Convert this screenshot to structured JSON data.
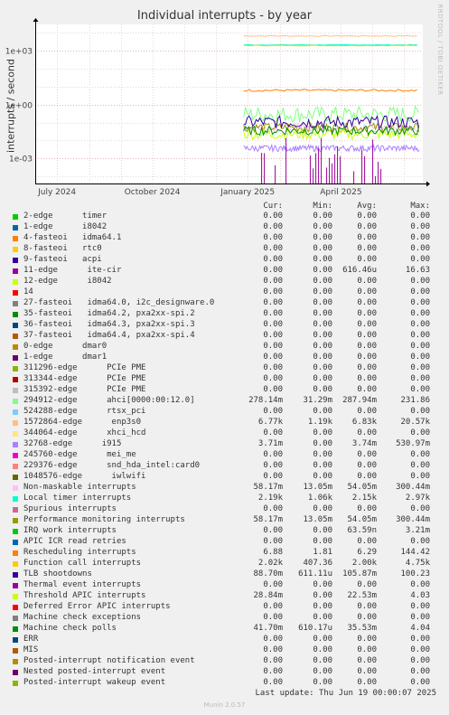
{
  "title": "Individual interrupts - by year",
  "side_text": "RRDTOOL / TOBI OETIKER",
  "footer": "Munin 2.0.57",
  "last_update": "Last update: Thu Jun 19 00:00:07 2025",
  "headers": {
    "cur": "Cur:",
    "min": "Min:",
    "avg": "Avg:",
    "max": "Max:"
  },
  "chart_data": {
    "type": "line",
    "ylabel": "interrupts / second",
    "yscale": "log",
    "ylim": [
      4e-05,
      30000
    ],
    "y_ticks": [
      {
        "value": 1000,
        "label": "1e+03"
      },
      {
        "value": 1,
        "label": "1e+00"
      },
      {
        "value": 0.001,
        "label": "1e-03"
      }
    ],
    "x_ticks": [
      "July 2024",
      "October 2024",
      "January 2025",
      "April 2025"
    ],
    "x_tick_dates": [
      "2024-07-01",
      "2024-10-01",
      "2025-01-01",
      "2025-04-01"
    ],
    "xlim": [
      "2024-06-10",
      "2025-06-19"
    ],
    "data_start": "2024-12-28",
    "grid": true,
    "series": [
      {
        "name": "2-edge      timer",
        "color": "#00cc00",
        "cur": "0.00",
        "min": "0.00",
        "avg": "0.00",
        "max": "0.00"
      },
      {
        "name": "1-edge      i8042",
        "color": "#0066b3",
        "cur": "0.00",
        "min": "0.00",
        "avg": "0.00",
        "max": "0.00"
      },
      {
        "name": "4-fasteoi   idma64.1",
        "color": "#ff8000",
        "cur": "0.00",
        "min": "0.00",
        "avg": "0.00",
        "max": "0.00"
      },
      {
        "name": "8-fasteoi   rtc0",
        "color": "#ffcc00",
        "cur": "0.00",
        "min": "0.00",
        "avg": "0.00",
        "max": "0.00"
      },
      {
        "name": "9-fasteoi   acpi",
        "color": "#330099",
        "cur": "0.00",
        "min": "0.00",
        "avg": "0.00",
        "max": "0.00"
      },
      {
        "name": "11-edge      ite-cir",
        "color": "#990099",
        "cur": "0.00",
        "min": "0.00",
        "avg": "616.46u",
        "max": "16.63"
      },
      {
        "name": "12-edge      i8042",
        "color": "#ccff00",
        "cur": "0.00",
        "min": "0.00",
        "avg": "0.00",
        "max": "0.00"
      },
      {
        "name": "14",
        "color": "#ff0000",
        "cur": "0.00",
        "min": "0.00",
        "avg": "0.00",
        "max": "0.00"
      },
      {
        "name": "27-fasteoi   idma64.0, i2c_designware.0",
        "color": "#808080",
        "cur": "0.00",
        "min": "0.00",
        "avg": "0.00",
        "max": "0.00"
      },
      {
        "name": "35-fasteoi   idma64.2, pxa2xx-spi.2",
        "color": "#008f00",
        "cur": "0.00",
        "min": "0.00",
        "avg": "0.00",
        "max": "0.00"
      },
      {
        "name": "36-fasteoi   idma64.3, pxa2xx-spi.3",
        "color": "#00487d",
        "cur": "0.00",
        "min": "0.00",
        "avg": "0.00",
        "max": "0.00"
      },
      {
        "name": "37-fasteoi   idma64.4, pxa2xx-spi.4",
        "color": "#b35a00",
        "cur": "0.00",
        "min": "0.00",
        "avg": "0.00",
        "max": "0.00"
      },
      {
        "name": "0-edge      dmar0",
        "color": "#b38f00",
        "cur": "0.00",
        "min": "0.00",
        "avg": "0.00",
        "max": "0.00"
      },
      {
        "name": "1-edge      dmar1",
        "color": "#6b006b",
        "cur": "0.00",
        "min": "0.00",
        "avg": "0.00",
        "max": "0.00"
      },
      {
        "name": "311296-edge      PCIe PME",
        "color": "#8fb300",
        "cur": "0.00",
        "min": "0.00",
        "avg": "0.00",
        "max": "0.00"
      },
      {
        "name": "313344-edge      PCIe PME",
        "color": "#b30000",
        "cur": "0.00",
        "min": "0.00",
        "avg": "0.00",
        "max": "0.00"
      },
      {
        "name": "315392-edge      PCIe PME",
        "color": "#bebebe",
        "cur": "0.00",
        "min": "0.00",
        "avg": "0.00",
        "max": "0.00"
      },
      {
        "name": "294912-edge      ahci[0000:00:12.0]",
        "color": "#80ff80",
        "cur": "278.14m",
        "min": "31.29m",
        "avg": "287.94m",
        "max": "231.86"
      },
      {
        "name": "524288-edge      rtsx_pci",
        "color": "#80c9ff",
        "cur": "0.00",
        "min": "0.00",
        "avg": "0.00",
        "max": "0.00"
      },
      {
        "name": "1572864-edge      enp3s0",
        "color": "#ffc080",
        "cur": "6.77k",
        "min": "1.19k",
        "avg": "6.83k",
        "max": "20.57k"
      },
      {
        "name": "344064-edge      xhci_hcd",
        "color": "#ffe680",
        "cur": "0.00",
        "min": "0.00",
        "avg": "0.00",
        "max": "0.00"
      },
      {
        "name": "32768-edge      i915",
        "color": "#aa80ff",
        "cur": "3.71m",
        "min": "0.00",
        "avg": "3.74m",
        "max": "530.97m"
      },
      {
        "name": "245760-edge      mei_me",
        "color": "#ee00cc",
        "cur": "0.00",
        "min": "0.00",
        "avg": "0.00",
        "max": "0.00"
      },
      {
        "name": "229376-edge      snd_hda_intel:card0",
        "color": "#ff8080",
        "cur": "0.00",
        "min": "0.00",
        "avg": "0.00",
        "max": "0.00"
      },
      {
        "name": "1048576-edge      iwlwifi",
        "color": "#666600",
        "cur": "0.00",
        "min": "0.00",
        "avg": "0.00",
        "max": "0.00"
      },
      {
        "name": "Non-maskable interrupts",
        "color": "#ffbfff",
        "cur": "58.17m",
        "min": "13.05m",
        "avg": "54.05m",
        "max": "300.44m"
      },
      {
        "name": "Local timer interrupts",
        "color": "#00ffcc",
        "cur": "2.19k",
        "min": "1.06k",
        "avg": "2.15k",
        "max": "2.97k"
      },
      {
        "name": "Spurious interrupts",
        "color": "#cc6699",
        "cur": "0.00",
        "min": "0.00",
        "avg": "0.00",
        "max": "0.00"
      },
      {
        "name": "Performance monitoring interrupts",
        "color": "#999900",
        "cur": "58.17m",
        "min": "13.05m",
        "avg": "54.05m",
        "max": "300.44m"
      },
      {
        "name": "IRQ work interrupts",
        "color": "#00cc00",
        "cur": "0.00",
        "min": "0.00",
        "avg": "63.59n",
        "max": "3.21m"
      },
      {
        "name": "APIC ICR read retries",
        "color": "#0066b3",
        "cur": "0.00",
        "min": "0.00",
        "avg": "0.00",
        "max": "0.00"
      },
      {
        "name": "Rescheduling interrupts",
        "color": "#ff8000",
        "cur": "6.88",
        "min": "1.81",
        "avg": "6.29",
        "max": "144.42"
      },
      {
        "name": "Function call interrupts",
        "color": "#ffcc00",
        "cur": "2.02k",
        "min": "407.36",
        "avg": "2.00k",
        "max": "4.75k"
      },
      {
        "name": "TLB shootdowns",
        "color": "#330099",
        "cur": "88.70m",
        "min": "611.11u",
        "avg": "105.87m",
        "max": "100.23"
      },
      {
        "name": "Thermal event interrupts",
        "color": "#990099",
        "cur": "0.00",
        "min": "0.00",
        "avg": "0.00",
        "max": "0.00"
      },
      {
        "name": "Threshold APIC interrupts",
        "color": "#ccff00",
        "cur": "28.84m",
        "min": "0.00",
        "avg": "22.53m",
        "max": "4.03"
      },
      {
        "name": "Deferred Error APIC interrupts",
        "color": "#ff0000",
        "cur": "0.00",
        "min": "0.00",
        "avg": "0.00",
        "max": "0.00"
      },
      {
        "name": "Machine check exceptions",
        "color": "#808080",
        "cur": "0.00",
        "min": "0.00",
        "avg": "0.00",
        "max": "0.00"
      },
      {
        "name": "Machine check polls",
        "color": "#008f00",
        "cur": "41.70m",
        "min": "610.17u",
        "avg": "35.53m",
        "max": "4.04"
      },
      {
        "name": "ERR",
        "color": "#00487d",
        "cur": "0.00",
        "min": "0.00",
        "avg": "0.00",
        "max": "0.00"
      },
      {
        "name": "MIS",
        "color": "#b35a00",
        "cur": "0.00",
        "min": "0.00",
        "avg": "0.00",
        "max": "0.00"
      },
      {
        "name": "Posted-interrupt notification event",
        "color": "#b38f00",
        "cur": "0.00",
        "min": "0.00",
        "avg": "0.00",
        "max": "0.00"
      },
      {
        "name": "Nested posted-interrupt event",
        "color": "#6b006b",
        "cur": "0.00",
        "min": "0.00",
        "avg": "0.00",
        "max": "0.00"
      },
      {
        "name": "Posted-interrupt wakeup event",
        "color": "#8fb300",
        "cur": "0.00",
        "min": "0.00",
        "avg": "0.00",
        "max": "0.00"
      }
    ]
  }
}
